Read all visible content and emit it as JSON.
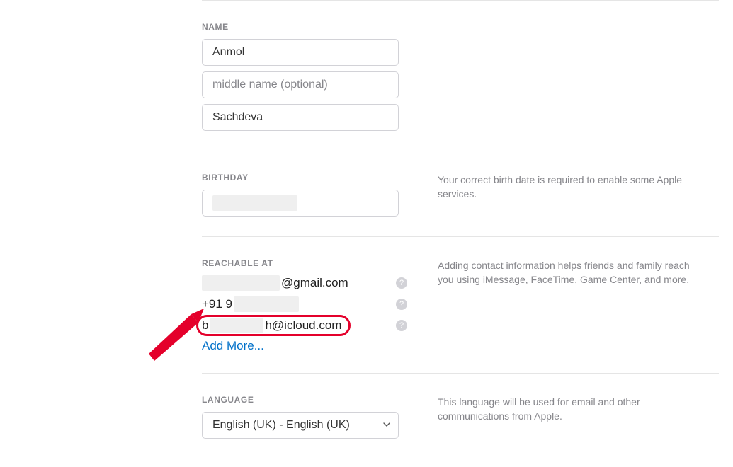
{
  "name_section": {
    "label": "NAME",
    "first_name": "Anmol",
    "middle_placeholder": "middle name (optional)",
    "last_name": "Sachdeva"
  },
  "birthday_section": {
    "label": "BIRTHDAY",
    "value_redacted": "",
    "help_text": "Your correct birth date is required to enable some Apple services."
  },
  "reachable_section": {
    "label": "REACHABLE AT",
    "contacts": {
      "gmail_suffix": "@gmail.com",
      "phone_prefix": "+91 9",
      "icloud_prefix": "b",
      "icloud_suffix": "h@icloud.com"
    },
    "add_more": "Add More...",
    "help_text": "Adding contact information helps friends and family reach you using iMessage, FaceTime, Game Center, and more.",
    "help_icon": "?"
  },
  "language_section": {
    "label": "LANGUAGE",
    "selected": "English (UK) - English (UK)",
    "help_text": "This language will be used for email and other communications from Apple."
  }
}
